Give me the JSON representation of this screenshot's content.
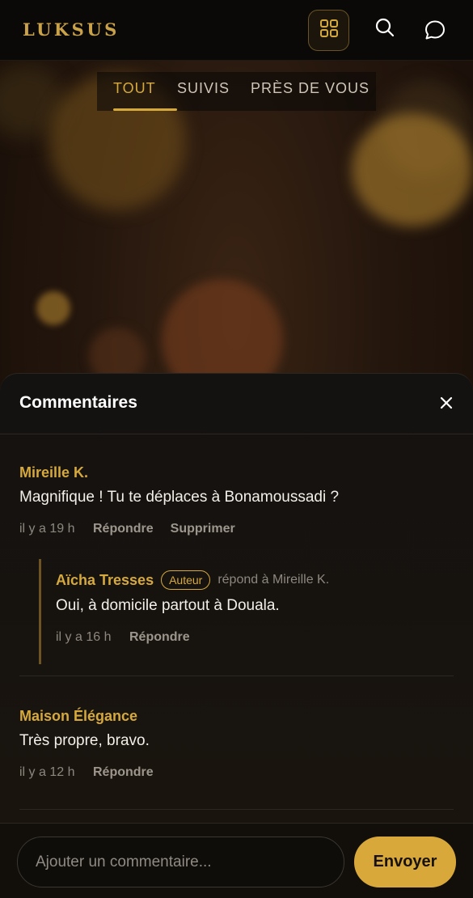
{
  "app": {
    "logo": "LUKSUS"
  },
  "tabs": [
    {
      "label": "TOUT",
      "active": true
    },
    {
      "label": "SUIVIS",
      "active": false
    },
    {
      "label": "PRÈS DE VOUS",
      "active": false
    }
  ],
  "comments_sheet": {
    "title": "Commentaires",
    "comments": [
      {
        "author": "Mireille K.",
        "text": "Magnifique ! Tu te déplaces à Bonamoussadi ?",
        "time": "il y a 19 h",
        "actions": [
          "Répondre",
          "Supprimer"
        ],
        "replies": [
          {
            "author": "Aïcha Tresses",
            "badge": "Auteur",
            "replying_to": "répond à Mireille K.",
            "text": "Oui, à domicile partout à Douala.",
            "time": "il y a 16 h",
            "actions": [
              "Répondre"
            ]
          }
        ]
      },
      {
        "author": "Maison Élégance",
        "text": "Très propre, bravo.",
        "time": "il y a 12 h",
        "actions": [
          "Répondre"
        ]
      }
    ],
    "input": {
      "placeholder": "Ajouter un commentaire...",
      "value": ""
    },
    "send_label": "Envoyer"
  },
  "colors": {
    "accent": "#d6a93c",
    "header_bg": "#0b0907",
    "sheet_bg": "#141210"
  },
  "icons": [
    "grid-icon",
    "search-icon",
    "chat-bubble-icon",
    "close-icon"
  ]
}
